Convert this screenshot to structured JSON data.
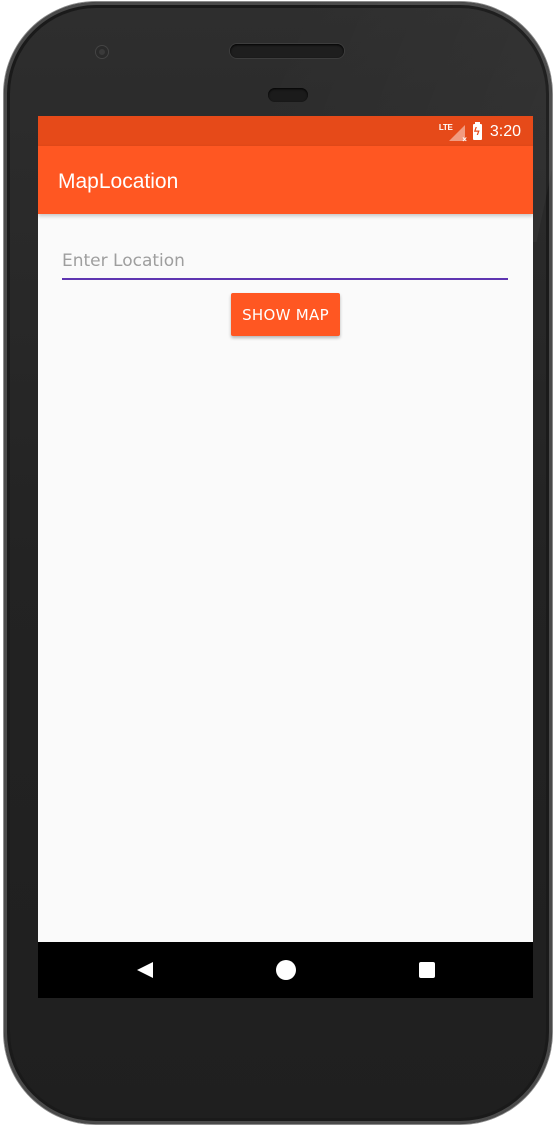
{
  "status_bar": {
    "network_label": "LTE",
    "time": "3:20",
    "icons": [
      "lte-signal-icon",
      "battery-charging-icon"
    ],
    "color": "#e64a19"
  },
  "app_bar": {
    "title": "MapLocation",
    "color": "#ff5722"
  },
  "form": {
    "location_input": {
      "value": "",
      "placeholder": "Enter Location",
      "underline_color": "#5e35b1"
    },
    "show_map_button": {
      "label": "SHOW MAP",
      "color": "#ff5722"
    }
  },
  "nav_bar": {
    "icons": [
      "back-icon",
      "home-icon",
      "recents-icon"
    ]
  }
}
